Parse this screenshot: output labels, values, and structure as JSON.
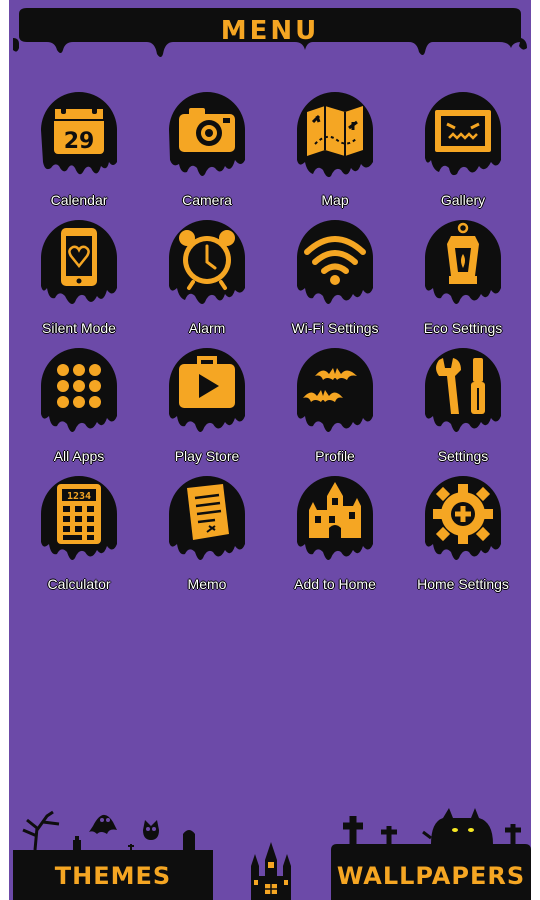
{
  "header": {
    "title": "MENU"
  },
  "apps": [
    {
      "label": "Calendar",
      "icon": "calendar-icon"
    },
    {
      "label": "Camera",
      "icon": "camera-icon"
    },
    {
      "label": "Map",
      "icon": "map-icon"
    },
    {
      "label": "Gallery",
      "icon": "gallery-icon"
    },
    {
      "label": "Silent Mode",
      "icon": "silent-mode-icon"
    },
    {
      "label": "Alarm",
      "icon": "alarm-icon"
    },
    {
      "label": "Wi-Fi Settings",
      "icon": "wifi-icon"
    },
    {
      "label": "Eco Settings",
      "icon": "lantern-icon"
    },
    {
      "label": "All Apps",
      "icon": "all-apps-grid-icon"
    },
    {
      "label": "Play Store",
      "icon": "play-store-icon"
    },
    {
      "label": "Profile",
      "icon": "bats-icon"
    },
    {
      "label": "Settings",
      "icon": "tools-icon"
    },
    {
      "label": "Calculator",
      "icon": "calculator-icon"
    },
    {
      "label": "Memo",
      "icon": "memo-icon"
    },
    {
      "label": "Add to Home",
      "icon": "haunted-house-icon"
    },
    {
      "label": "Home Settings",
      "icon": "gear-icon"
    }
  ],
  "calendar_day": "29",
  "calculator_display": "1234",
  "footer": {
    "themes_label": "THEMES",
    "wallpapers_label": "WALLPAPERS"
  },
  "colors": {
    "background": "#6c4aa8",
    "accent": "#f5a623",
    "black": "#0e0e0e"
  }
}
